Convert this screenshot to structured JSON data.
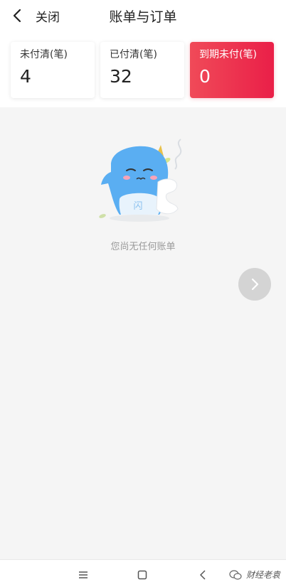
{
  "header": {
    "back_icon": "chevron-left-icon",
    "close_label": "关闭",
    "title": "账单与订单"
  },
  "stats": [
    {
      "label": "未付清(笔)",
      "value": "4"
    },
    {
      "label": "已付清(笔)",
      "value": "32"
    },
    {
      "label": "到期未付(笔)",
      "value": "0"
    }
  ],
  "colors": {
    "overdue_gradient_start": "#f04a58",
    "overdue_gradient_end": "#ea1f48",
    "mascot_blue": "#5aaef2",
    "fab_gray": "#d4d4d4"
  },
  "empty_state": {
    "illustration": "sad-mascot-illustration",
    "mascot_badge": "闪",
    "message": "您尚无任何账单"
  },
  "fab": {
    "icon": "chevron-right-icon"
  },
  "system_nav": {
    "menu_icon": "menu-icon",
    "home_icon": "square-home-icon",
    "back_icon": "triangle-back-icon"
  },
  "watermark": {
    "icon": "wechat-icon",
    "text": "财经老袁"
  }
}
